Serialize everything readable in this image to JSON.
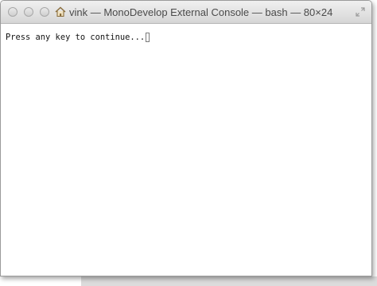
{
  "window": {
    "title": "vink — MonoDevelop External Console — bash — 80×24"
  },
  "icons": {
    "title": "home-icon",
    "resize": "fullscreen-icon"
  },
  "console": {
    "text": "Press any key to continue..."
  }
}
